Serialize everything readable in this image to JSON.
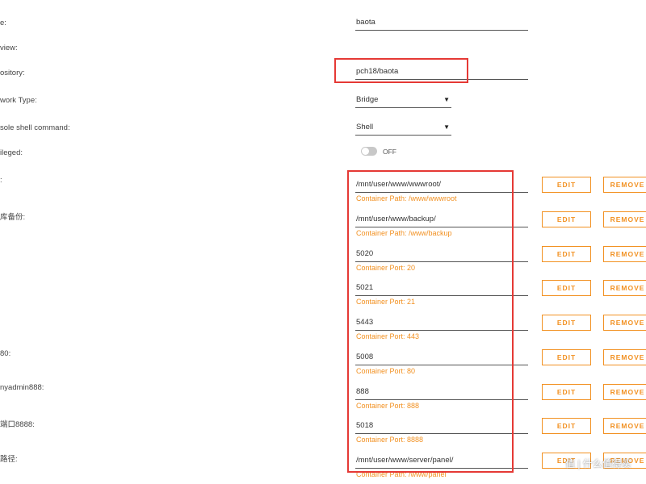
{
  "labels": [
    "e:",
    "view:",
    "ository:",
    "work Type:",
    "sole shell command:",
    "ileged:",
    ":",
    "库备份:",
    "80:",
    "nyadmin888:",
    "端口8888:",
    "路径:"
  ],
  "name_value": "baota",
  "repository_value": "pch18/baota",
  "network_type": "Bridge",
  "console_shell": "Shell",
  "privileged_state": "OFF",
  "mappings": [
    {
      "value": "/mnt/user/www/wwwroot/",
      "sub": "Container Path: /www/wwwroot"
    },
    {
      "value": "/mnt/user/www/backup/",
      "sub": "Container Path: /www/backup"
    },
    {
      "value": "5020",
      "sub": "Container Port: 20"
    },
    {
      "value": "5021",
      "sub": "Container Port: 21"
    },
    {
      "value": "5443",
      "sub": "Container Port: 443"
    },
    {
      "value": "5008",
      "sub": "Container Port: 80"
    },
    {
      "value": "888",
      "sub": "Container Port: 888"
    },
    {
      "value": "5018",
      "sub": "Container Port: 8888"
    },
    {
      "value": "/mnt/user/www/server/panel/",
      "sub": "Container Path: /www/panel"
    }
  ],
  "buttons": {
    "edit": "EDIT",
    "remove": "REMOVE"
  },
  "icons": {
    "caret": "caret-down-icon"
  },
  "colors": {
    "accent": "#f29122",
    "highlight": "#e53935"
  },
  "watermark": "值 | 什么值得买"
}
